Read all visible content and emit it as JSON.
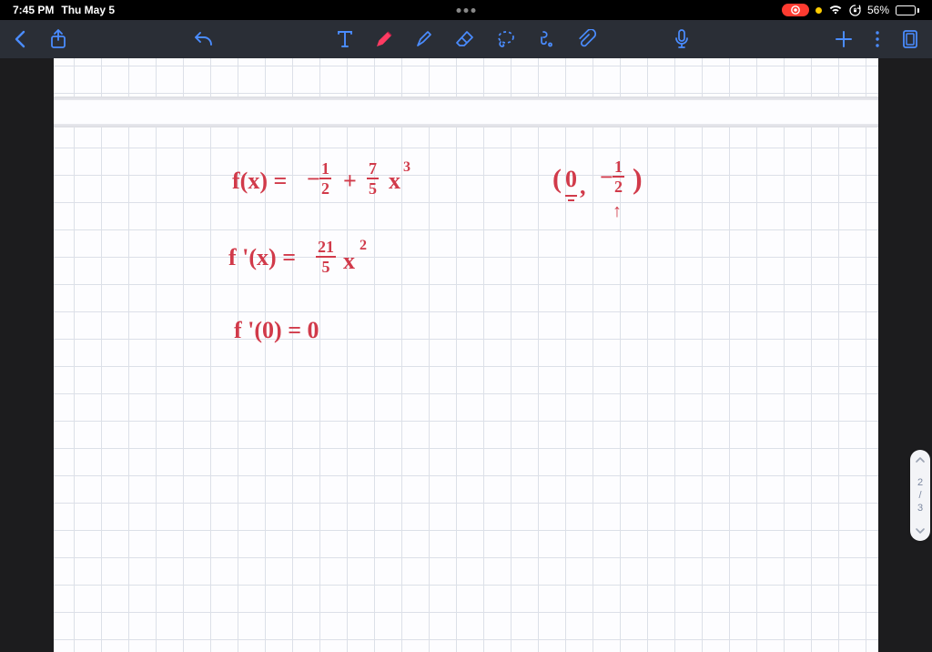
{
  "status": {
    "time": "7:45 PM",
    "date": "Thu May 5",
    "battery_pct": "56%",
    "battery_fill_pct": 56
  },
  "toolbar": {
    "icons": {
      "back": "back-chevron",
      "share": "share",
      "undo": "undo",
      "text_tool": "T",
      "pen": "pen",
      "pencil": "pencil",
      "eraser": "eraser",
      "lasso": "lasso",
      "shapes": "hand-shapes",
      "link": "attachment",
      "mic": "microphone",
      "add": "plus",
      "more": "more-vertical",
      "pages": "pages"
    }
  },
  "page_indicator": {
    "current": "2",
    "separator": "/",
    "total": "3"
  },
  "notes": {
    "line1_fx": "f(x) =",
    "line1_neg": "−",
    "line1_half_n": "1",
    "line1_half_d": "2",
    "line1_plus": "+",
    "line1_75_n": "7",
    "line1_75_d": "5",
    "line1_x": "x",
    "line1_cubed": "3",
    "point_open": "(",
    "point_zero": "0",
    "point_comma": ",",
    "point_neg": "−",
    "point_half_n": "1",
    "point_half_d": "2",
    "point_close": ")",
    "arrow": "↑",
    "line2_fprimex": "f '(x) =",
    "line2_215_n": "21",
    "line2_215_d": "5",
    "line2_x": "x",
    "line2_sq": "2",
    "line3": "f '(0) =  0"
  }
}
